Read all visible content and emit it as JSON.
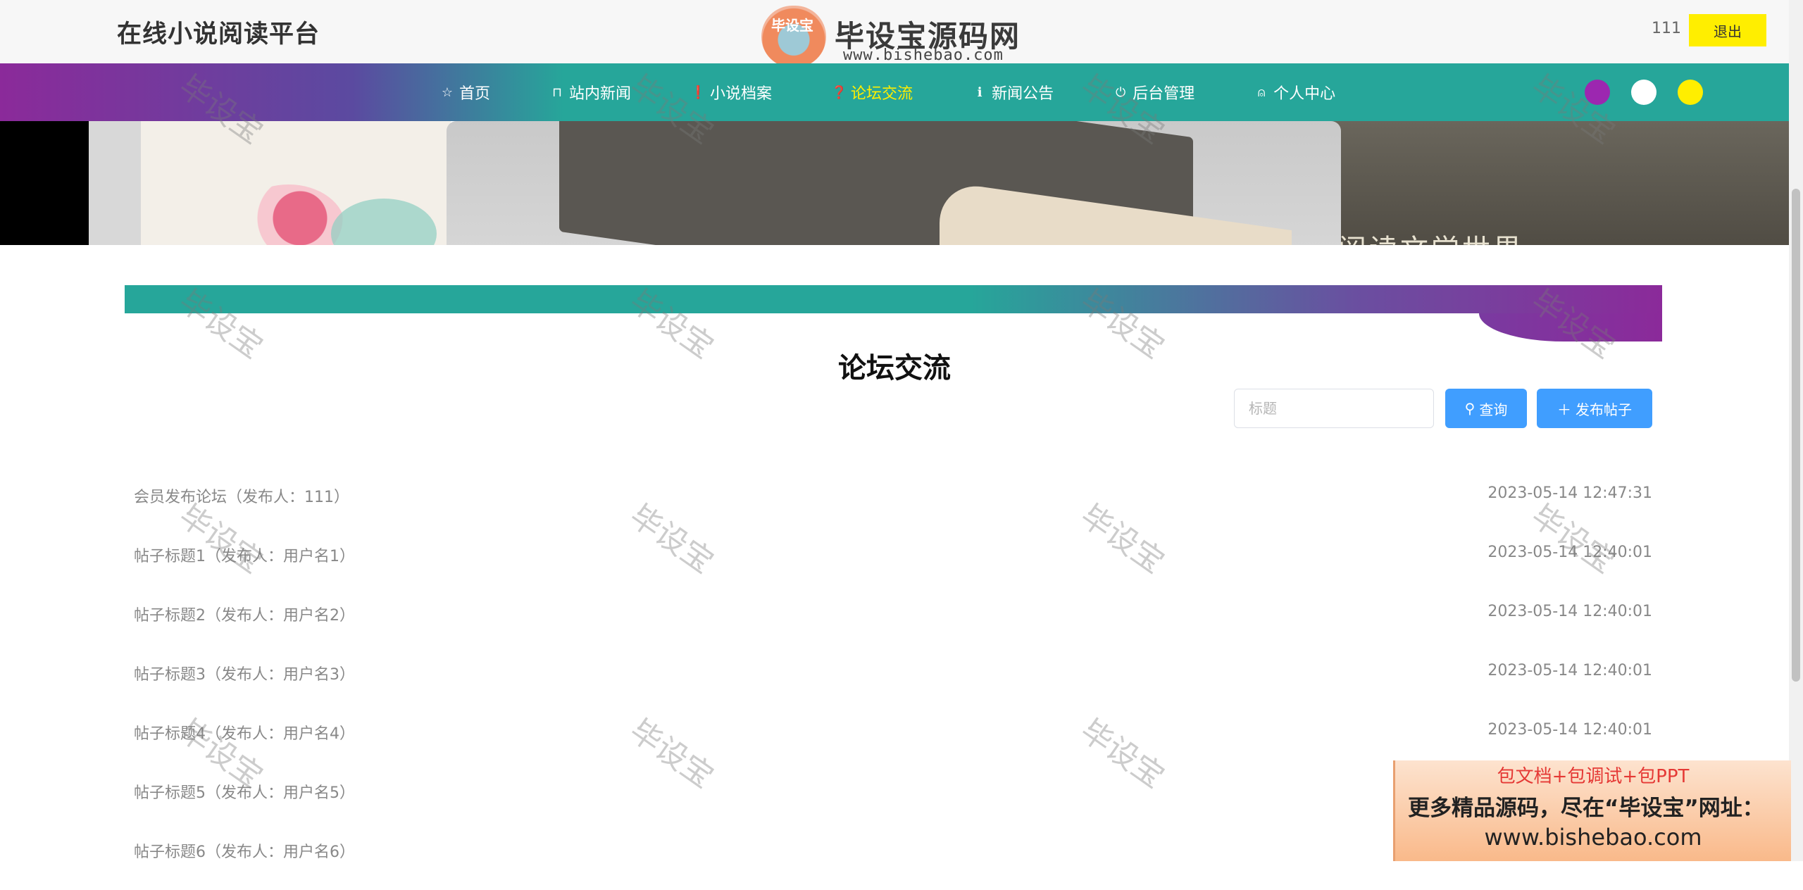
{
  "header": {
    "site_title": "在线小说阅读平台",
    "logo": {
      "badge_text": "毕设宝",
      "name": "毕设宝源码网",
      "url": "www.bishebao.com"
    },
    "username": "111",
    "logout_label": "退出"
  },
  "nav": {
    "items": [
      {
        "label": "首页",
        "icon": "star-icon",
        "active": false
      },
      {
        "label": "站内新闻",
        "icon": "bag-icon",
        "active": false
      },
      {
        "label": "小说档案",
        "icon": "warning-icon",
        "active": false
      },
      {
        "label": "论坛交流",
        "icon": "question-icon",
        "active": true
      },
      {
        "label": "新闻公告",
        "icon": "info-icon",
        "active": false
      },
      {
        "label": "后台管理",
        "icon": "power-icon",
        "active": false
      },
      {
        "label": "个人中心",
        "icon": "user-icon",
        "active": false
      }
    ],
    "theme_colors": [
      "#9c27b0",
      "#ffffff",
      "#ffee00"
    ],
    "active_color": "#ffee00"
  },
  "banner": {
    "right_text": "阅读文学世界",
    "slide_count": 3,
    "active_slide": 1
  },
  "forum": {
    "title": "论坛交流",
    "search_placeholder": "标题",
    "search_value": "",
    "search_label": "查询",
    "publish_label": "发布帖子",
    "posts": [
      {
        "title": "会员发布论坛（发布人：111）",
        "time": "2023-05-14 12:47:31"
      },
      {
        "title": "帖子标题1（发布人：用户名1）",
        "time": "2023-05-14 12:40:01"
      },
      {
        "title": "帖子标题2（发布人：用户名2）",
        "time": "2023-05-14 12:40:01"
      },
      {
        "title": "帖子标题3（发布人：用户名3）",
        "time": "2023-05-14 12:40:01"
      },
      {
        "title": "帖子标题4（发布人：用户名4）",
        "time": "2023-05-14 12:40:01"
      },
      {
        "title": "帖子标题5（发布人：用户名5）",
        "time": ""
      },
      {
        "title": "帖子标题6（发布人：用户名6）",
        "time": ""
      }
    ]
  },
  "ad": {
    "line1": "包文档+包调试+包PPT",
    "line2": "更多精品源码，尽在“毕设宝”网址：",
    "line3": "www.bishebao.com"
  },
  "watermark": {
    "text": "毕设宝"
  },
  "colors": {
    "teal": "#26a69a",
    "purple": "#8b2a9a",
    "button_blue": "#409eff",
    "logout_yellow": "#ffee00"
  }
}
